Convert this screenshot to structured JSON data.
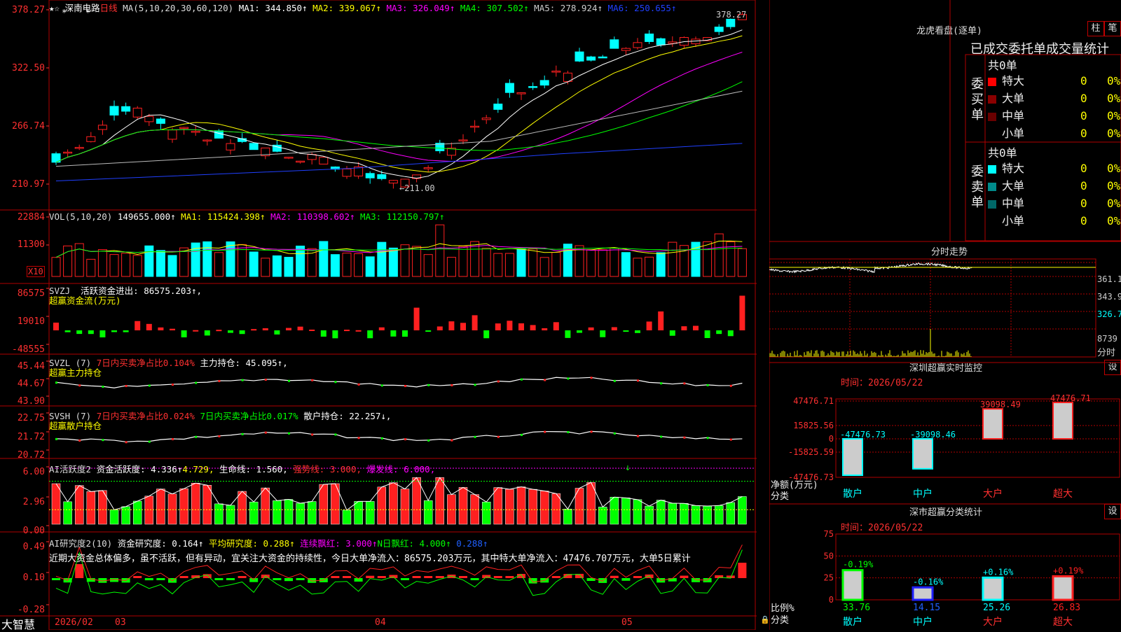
{
  "colors": {
    "up": "#ff2020",
    "down": "#00ffff",
    "grid": "#b00000",
    "bg": "#000000",
    "green": "#00ff00",
    "yellow": "#ffff00",
    "magenta": "#ff00ff"
  },
  "kline": {
    "stock": "深南电路",
    "period": "日线",
    "ma_params": "MA(5,10,20,30,60,120)",
    "ma_values": [
      {
        "label": "MA1:",
        "value": "344.850↑",
        "color": "#ffffff"
      },
      {
        "label": "MA2:",
        "value": "339.067↑",
        "color": "#ffff00"
      },
      {
        "label": "MA3:",
        "value": "326.049↑",
        "color": "#ff00ff"
      },
      {
        "label": "MA4:",
        "value": "307.502↑",
        "color": "#00ff00"
      },
      {
        "label": "MA5:",
        "value": "278.924↑",
        "color": "#cccccc"
      },
      {
        "label": "MA6:",
        "value": "250.655↑",
        "color": "#2040ff"
      }
    ],
    "y_ticks": [
      "378.27",
      "322.50",
      "266.74",
      "210.97"
    ],
    "high_label": "378.27",
    "low_label": "211.00"
  },
  "vol": {
    "header": "VOL(5,10,20)",
    "value": "149655.000↑",
    "ma": [
      {
        "label": "MA1:",
        "value": "115424.398↑",
        "color": "#ffff00"
      },
      {
        "label": "MA2:",
        "value": "110398.602↑",
        "color": "#ff00ff"
      },
      {
        "label": "MA3:",
        "value": "112150.797↑",
        "color": "#00ff00"
      }
    ],
    "y_ticks": [
      "22884",
      "11300"
    ],
    "unit": "X10"
  },
  "svzj": {
    "header": "SVZJ",
    "label": "活跃资金进出:",
    "value": "86575.203↑,",
    "sub": "超赢资金流(万元)",
    "y_ticks": [
      "86575",
      "19010",
      "-48555"
    ]
  },
  "svzl": {
    "header": "SVZL (7)",
    "p1": "7日内买卖净占比0.104%",
    "p2": "主力持仓:",
    "p2v": "45.095↑,",
    "sub": "超赢主力持仓",
    "y_ticks": [
      "45.44",
      "44.67",
      "43.90"
    ]
  },
  "svsh": {
    "header": "SVSH (7)",
    "p1": "7日内买卖净占比0.024%",
    "p2": "7日内买卖净占比0.017%",
    "p3": "散户持仓:",
    "p3v": "22.257↓,",
    "sub": "超赢散户持仓",
    "y_ticks": [
      "22.75",
      "21.72",
      "20.72"
    ]
  },
  "ai1": {
    "header": "AI活跃度2",
    "p1": "资金活跃度:",
    "p1v": "4.336↑",
    "p2": "4.729,",
    "p3": "生命线:",
    "p3v": "1.560,",
    "p4": "强势线:",
    "p4v": "3.000,",
    "p5": "爆发线:",
    "p5v": "6.000,",
    "y_ticks": [
      "6.00",
      "2.96",
      "0.00"
    ]
  },
  "ai2": {
    "header": "AI研究度2(10)",
    "p1": "资金研究度:",
    "p1v": "0.164↑",
    "p2": "平均研究度:",
    "p2v": "0.288↑",
    "p3": "连续飘红:",
    "p3v": "3.000↑",
    "p4": "N日飘红:",
    "p4v": "4.000↑",
    "p5": "0.288↑",
    "note": "近期大资金总体偏多，虽不活跃，但有异动，宜关注大资金的持续性，今日大单净流入：86575.203万元，其中特大单净流入：47476.707万元，大单5日累计",
    "y_ticks": [
      "0.49",
      "0.10",
      "-0.28"
    ]
  },
  "xaxis": {
    "brand": "大智慧",
    "labels": [
      "2026/02",
      "03",
      "04",
      "05"
    ]
  },
  "lhb": {
    "title": "龙虎看盘(逐单)",
    "btn1": "柱",
    "btn2": "笔",
    "tabs": "已成交委托单成交量统计",
    "buy": {
      "label": "委买单",
      "count": "共0单",
      "rows": [
        {
          "name": "特大",
          "v": "0",
          "p": "0%",
          "c": "#ff0000"
        },
        {
          "name": "大单",
          "v": "0",
          "p": "0%",
          "c": "#8b0000"
        },
        {
          "name": "中单",
          "v": "0",
          "p": "0%",
          "c": "#6a0000"
        },
        {
          "name": "小单",
          "v": "0",
          "p": "0%",
          "c": "#000000"
        }
      ]
    },
    "sell": {
      "label": "委卖单",
      "count": "共0单",
      "rows": [
        {
          "name": "特大",
          "v": "0",
          "p": "0%",
          "c": "#00ffff"
        },
        {
          "name": "大单",
          "v": "0",
          "p": "0%",
          "c": "#008b8b"
        },
        {
          "name": "中单",
          "v": "0",
          "p": "0%",
          "c": "#006868"
        },
        {
          "name": "小单",
          "v": "0",
          "p": "0%",
          "c": "#000000"
        }
      ]
    }
  },
  "fenshi": {
    "title": "分时走势",
    "y_ticks": [
      "361.1",
      "343.9",
      "326.7",
      "8739"
    ],
    "foot": "分时"
  },
  "monitor": {
    "title": "深圳超赢实时监控",
    "btn": "设",
    "time": "时间：2026/05/22",
    "y_ticks": [
      "47476.71",
      "15825.56",
      "0",
      "-15825.59",
      "-47476.73"
    ],
    "ylab": "净额(万元)",
    "xlab": "分类",
    "bars": [
      {
        "name": "散户",
        "value": -47476.73,
        "label": "-47476.73"
      },
      {
        "name": "中户",
        "value": -39098.46,
        "label": "-39098.46"
      },
      {
        "name": "大户",
        "value": 39098.49,
        "label": "39098.49"
      },
      {
        "name": "超大",
        "value": 47476.71,
        "label": "47476.71"
      }
    ]
  },
  "classify": {
    "title": "深市超赢分类统计",
    "btn": "设",
    "time": "时间：2026/05/22",
    "y_ticks": [
      "75",
      "50",
      "25",
      "0"
    ],
    "ylab": "比例%",
    "xlab": "分类",
    "bars": [
      {
        "name": "散户",
        "value": 33.76,
        "label": "33.76",
        "delta": "-0.19%",
        "c": "#00ff00"
      },
      {
        "name": "中户",
        "value": 14.15,
        "label": "14.15",
        "delta": "-0.16%",
        "c": "#2020ff"
      },
      {
        "name": "大户",
        "value": 25.26,
        "label": "25.26",
        "delta": "+0.16%",
        "c": "#00ffff"
      },
      {
        "name": "超大",
        "value": 26.83,
        "label": "26.83",
        "delta": "+0.19%",
        "c": "#ff2020"
      }
    ]
  }
}
